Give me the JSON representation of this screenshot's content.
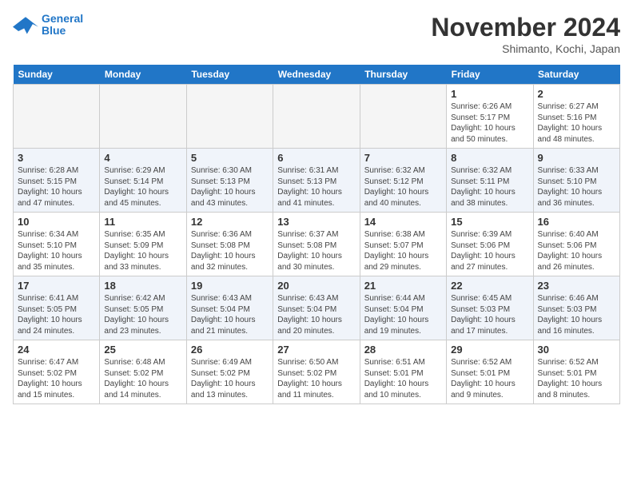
{
  "header": {
    "logo_line1": "General",
    "logo_line2": "Blue",
    "month": "November 2024",
    "location": "Shimanto, Kochi, Japan"
  },
  "weekdays": [
    "Sunday",
    "Monday",
    "Tuesday",
    "Wednesday",
    "Thursday",
    "Friday",
    "Saturday"
  ],
  "weeks": [
    [
      {
        "day": "",
        "detail": ""
      },
      {
        "day": "",
        "detail": ""
      },
      {
        "day": "",
        "detail": ""
      },
      {
        "day": "",
        "detail": ""
      },
      {
        "day": "",
        "detail": ""
      },
      {
        "day": "1",
        "detail": "Sunrise: 6:26 AM\nSunset: 5:17 PM\nDaylight: 10 hours\nand 50 minutes."
      },
      {
        "day": "2",
        "detail": "Sunrise: 6:27 AM\nSunset: 5:16 PM\nDaylight: 10 hours\nand 48 minutes."
      }
    ],
    [
      {
        "day": "3",
        "detail": "Sunrise: 6:28 AM\nSunset: 5:15 PM\nDaylight: 10 hours\nand 47 minutes."
      },
      {
        "day": "4",
        "detail": "Sunrise: 6:29 AM\nSunset: 5:14 PM\nDaylight: 10 hours\nand 45 minutes."
      },
      {
        "day": "5",
        "detail": "Sunrise: 6:30 AM\nSunset: 5:13 PM\nDaylight: 10 hours\nand 43 minutes."
      },
      {
        "day": "6",
        "detail": "Sunrise: 6:31 AM\nSunset: 5:13 PM\nDaylight: 10 hours\nand 41 minutes."
      },
      {
        "day": "7",
        "detail": "Sunrise: 6:32 AM\nSunset: 5:12 PM\nDaylight: 10 hours\nand 40 minutes."
      },
      {
        "day": "8",
        "detail": "Sunrise: 6:32 AM\nSunset: 5:11 PM\nDaylight: 10 hours\nand 38 minutes."
      },
      {
        "day": "9",
        "detail": "Sunrise: 6:33 AM\nSunset: 5:10 PM\nDaylight: 10 hours\nand 36 minutes."
      }
    ],
    [
      {
        "day": "10",
        "detail": "Sunrise: 6:34 AM\nSunset: 5:10 PM\nDaylight: 10 hours\nand 35 minutes."
      },
      {
        "day": "11",
        "detail": "Sunrise: 6:35 AM\nSunset: 5:09 PM\nDaylight: 10 hours\nand 33 minutes."
      },
      {
        "day": "12",
        "detail": "Sunrise: 6:36 AM\nSunset: 5:08 PM\nDaylight: 10 hours\nand 32 minutes."
      },
      {
        "day": "13",
        "detail": "Sunrise: 6:37 AM\nSunset: 5:08 PM\nDaylight: 10 hours\nand 30 minutes."
      },
      {
        "day": "14",
        "detail": "Sunrise: 6:38 AM\nSunset: 5:07 PM\nDaylight: 10 hours\nand 29 minutes."
      },
      {
        "day": "15",
        "detail": "Sunrise: 6:39 AM\nSunset: 5:06 PM\nDaylight: 10 hours\nand 27 minutes."
      },
      {
        "day": "16",
        "detail": "Sunrise: 6:40 AM\nSunset: 5:06 PM\nDaylight: 10 hours\nand 26 minutes."
      }
    ],
    [
      {
        "day": "17",
        "detail": "Sunrise: 6:41 AM\nSunset: 5:05 PM\nDaylight: 10 hours\nand 24 minutes."
      },
      {
        "day": "18",
        "detail": "Sunrise: 6:42 AM\nSunset: 5:05 PM\nDaylight: 10 hours\nand 23 minutes."
      },
      {
        "day": "19",
        "detail": "Sunrise: 6:43 AM\nSunset: 5:04 PM\nDaylight: 10 hours\nand 21 minutes."
      },
      {
        "day": "20",
        "detail": "Sunrise: 6:43 AM\nSunset: 5:04 PM\nDaylight: 10 hours\nand 20 minutes."
      },
      {
        "day": "21",
        "detail": "Sunrise: 6:44 AM\nSunset: 5:04 PM\nDaylight: 10 hours\nand 19 minutes."
      },
      {
        "day": "22",
        "detail": "Sunrise: 6:45 AM\nSunset: 5:03 PM\nDaylight: 10 hours\nand 17 minutes."
      },
      {
        "day": "23",
        "detail": "Sunrise: 6:46 AM\nSunset: 5:03 PM\nDaylight: 10 hours\nand 16 minutes."
      }
    ],
    [
      {
        "day": "24",
        "detail": "Sunrise: 6:47 AM\nSunset: 5:02 PM\nDaylight: 10 hours\nand 15 minutes."
      },
      {
        "day": "25",
        "detail": "Sunrise: 6:48 AM\nSunset: 5:02 PM\nDaylight: 10 hours\nand 14 minutes."
      },
      {
        "day": "26",
        "detail": "Sunrise: 6:49 AM\nSunset: 5:02 PM\nDaylight: 10 hours\nand 13 minutes."
      },
      {
        "day": "27",
        "detail": "Sunrise: 6:50 AM\nSunset: 5:02 PM\nDaylight: 10 hours\nand 11 minutes."
      },
      {
        "day": "28",
        "detail": "Sunrise: 6:51 AM\nSunset: 5:01 PM\nDaylight: 10 hours\nand 10 minutes."
      },
      {
        "day": "29",
        "detail": "Sunrise: 6:52 AM\nSunset: 5:01 PM\nDaylight: 10 hours\nand 9 minutes."
      },
      {
        "day": "30",
        "detail": "Sunrise: 6:52 AM\nSunset: 5:01 PM\nDaylight: 10 hours\nand 8 minutes."
      }
    ]
  ]
}
